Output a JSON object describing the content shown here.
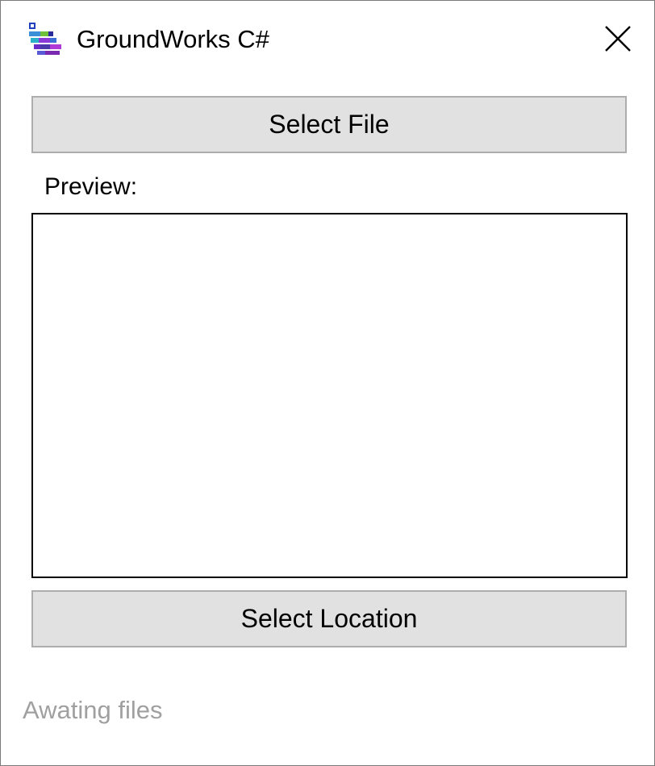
{
  "window": {
    "title": "GroundWorks C#",
    "app_icon": "groundworks-app-icon",
    "close_icon": "close-icon"
  },
  "main": {
    "select_file_label": "Select File",
    "preview_label": "Preview:",
    "preview_content": "",
    "select_location_label": "Select Location",
    "status_text": "Awating files"
  },
  "colors": {
    "button_bg": "#e1e1e1",
    "button_border": "#adadad",
    "status_text": "#a0a0a0",
    "preview_border": "#000000"
  }
}
